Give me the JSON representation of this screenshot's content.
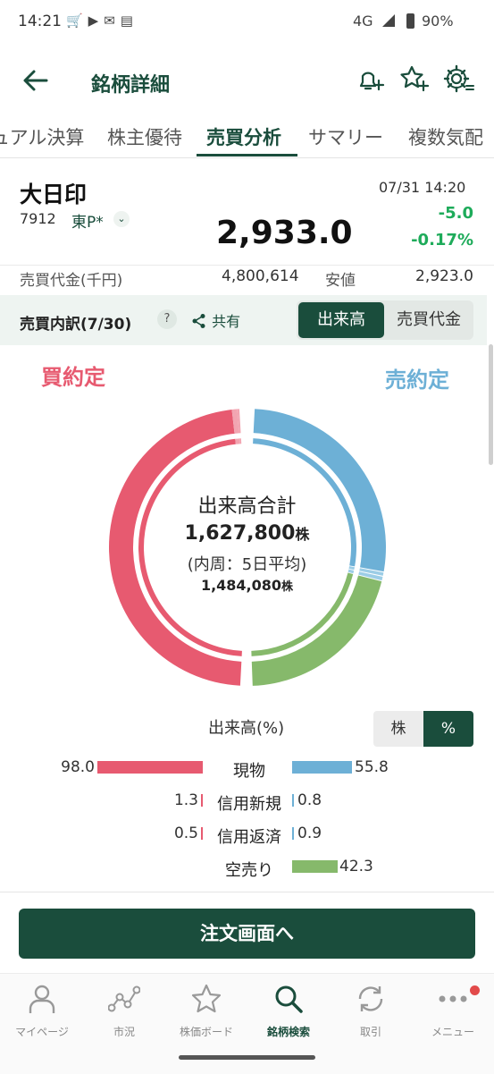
{
  "status_bar": {
    "time": "14:21",
    "network": "4G",
    "battery": "90%"
  },
  "app_bar": {
    "title": "銘柄詳細"
  },
  "tabs": [
    {
      "label": "ュアル決算"
    },
    {
      "label": "株主優待"
    },
    {
      "label": "売買分析",
      "active": true
    },
    {
      "label": "サマリー"
    },
    {
      "label": "複数気配"
    }
  ],
  "stock": {
    "name": "大日印",
    "code": "7912",
    "market": "東P*",
    "price": "2,933.0",
    "datetime": "07/31 14:20",
    "change": "-5.0",
    "change_pct": "-0.17%",
    "change_color": "#1eab5a"
  },
  "stats_row": {
    "label1": "売買代金(千円)",
    "value1": "4,800,614",
    "label2": "安値",
    "value2": "2,923.0"
  },
  "breakdown": {
    "title": "売買内訳(7/30)",
    "help": "?",
    "share_label": "共有",
    "segment": {
      "active": "出来高",
      "inactive": "売買代金"
    }
  },
  "chart": {
    "buy_label": "買約定",
    "sell_label": "売約定",
    "center_title": "出来高合計",
    "total": "1,627,800",
    "unit": "株",
    "inner_note": "(内周：5日平均)",
    "avg": "1,484,080",
    "colors": {
      "buy": "#e75a70",
      "sell_cash": "#6db0d6",
      "sell_short": "#86b96b"
    }
  },
  "chart_data": {
    "type": "pie",
    "title": "出来高合計",
    "series": [
      {
        "name": "買約定",
        "values": [
          98.0,
          1.3,
          0.5
        ]
      },
      {
        "name": "売約定",
        "values": [
          55.8,
          0.8,
          0.9,
          42.3
        ]
      }
    ]
  },
  "volume_table": {
    "label": "出来高(%)",
    "toggle": {
      "a": "株",
      "b": "%"
    },
    "rows": [
      {
        "category": "現物",
        "buy": 98.0,
        "buy_text": "98.0",
        "sell": 55.8,
        "sell_text": "55.8"
      },
      {
        "category": "信用新規",
        "buy": 1.3,
        "buy_text": "1.3",
        "sell": 0.8,
        "sell_text": "0.8"
      },
      {
        "category": "信用返済",
        "buy": 0.5,
        "buy_text": "0.5",
        "sell": 0.9,
        "sell_text": "0.9"
      },
      {
        "category": "空売り",
        "buy": null,
        "buy_text": "",
        "sell": 42.3,
        "sell_text": "42.3"
      }
    ]
  },
  "order_button": {
    "label": "注文画面へ"
  },
  "bottom_nav": [
    {
      "label": "マイページ",
      "icon": "person-icon"
    },
    {
      "label": "市況",
      "icon": "market-graph-icon"
    },
    {
      "label": "株価ボード",
      "icon": "star-icon"
    },
    {
      "label": "銘柄検索",
      "icon": "search-icon",
      "active": true
    },
    {
      "label": "取引",
      "icon": "refresh-icon"
    },
    {
      "label": "メニュー",
      "icon": "more-icon"
    }
  ]
}
